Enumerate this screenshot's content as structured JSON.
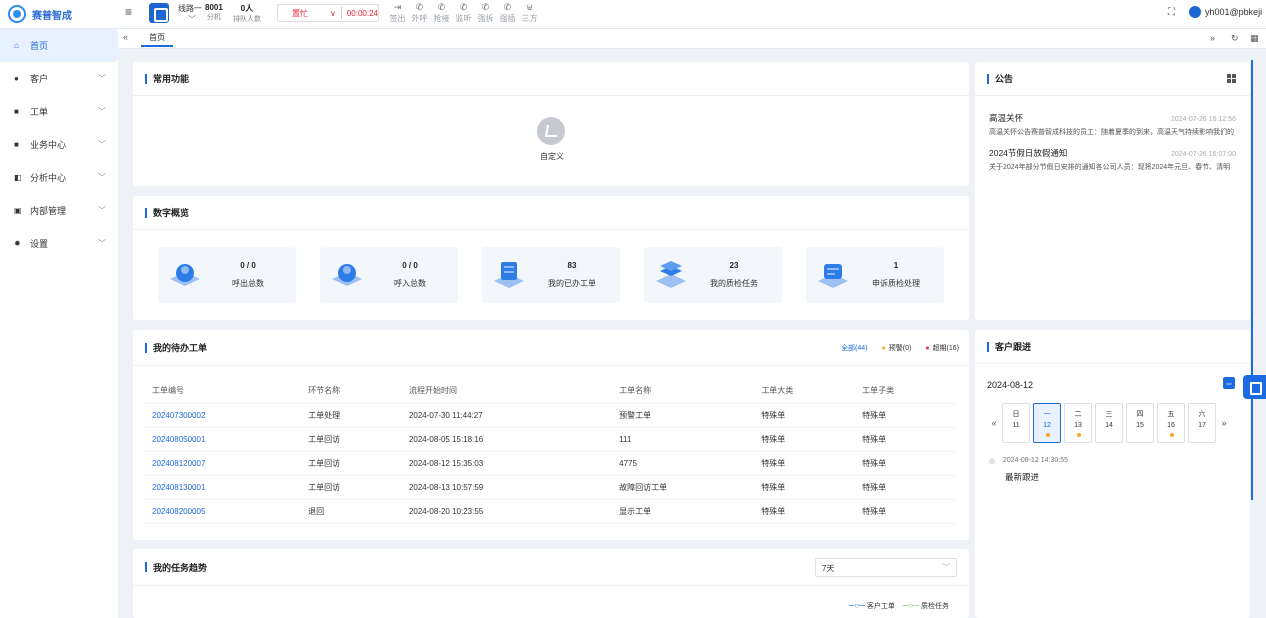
{
  "app": {
    "name": "赛普智成"
  },
  "topbar": {
    "line_label": "线路一",
    "extension": {
      "value": "8001",
      "label": "分机"
    },
    "queue": {
      "value": "0人",
      "label": "排队人数"
    },
    "agent_status": "置忙",
    "call_timer": "00:00:24",
    "tools": [
      "签出",
      "外呼",
      "抢接",
      "监听",
      "强拆",
      "强插",
      "三方"
    ],
    "username": "yh001@pbkeji"
  },
  "sidebar": {
    "items": [
      {
        "label": "首页",
        "icon": "home-icon",
        "active": true
      },
      {
        "label": "客户",
        "icon": "customer-icon"
      },
      {
        "label": "工单",
        "icon": "ticket-icon"
      },
      {
        "label": "业务中心",
        "icon": "business-icon"
      },
      {
        "label": "分析中心",
        "icon": "analytics-icon"
      },
      {
        "label": "内部管理",
        "icon": "internal-icon"
      },
      {
        "label": "设置",
        "icon": "settings-icon"
      }
    ]
  },
  "tabs": {
    "active": "首页"
  },
  "common_functions": {
    "title": "常用功能",
    "custom_label": "自定义"
  },
  "overview": {
    "title": "数字概览",
    "stats": [
      {
        "value": "0 / 0",
        "label": "呼出总数"
      },
      {
        "value": "0 / 0",
        "label": "呼入总数"
      },
      {
        "value": "83",
        "label": "我的已办工单"
      },
      {
        "value": "23",
        "label": "我的质检任务"
      },
      {
        "value": "1",
        "label": "申诉质检处理"
      }
    ]
  },
  "pending_orders": {
    "title": "我的待办工单",
    "filters": {
      "all": "全部(44)",
      "warning": "预警(0)",
      "overdue": "超期(16)"
    },
    "columns": [
      "工单编号",
      "环节名称",
      "流程开始时间",
      "工单名称",
      "工单大类",
      "工单子类"
    ],
    "rows": [
      [
        "202407300002",
        "工单处理",
        "2024-07-30 11:44:27",
        "预警工单",
        "特殊单",
        "特殊单"
      ],
      [
        "202408050001",
        "工单回访",
        "2024-08-05 15:18:16",
        "111",
        "特殊单",
        "特殊单"
      ],
      [
        "202408120007",
        "工单回访",
        "2024-08-12 15:35:03",
        "4775",
        "特殊单",
        "特殊单"
      ],
      [
        "202408130001",
        "工单回访",
        "2024-08-13 10:57:59",
        "故障回访工单",
        "特殊单",
        "特殊单"
      ],
      [
        "202408200005",
        "退回",
        "2024-08-20 10:23:55",
        "显示工单",
        "特殊单",
        "特殊单"
      ]
    ]
  },
  "task_trend": {
    "title": "我的任务趋势",
    "range": "7天",
    "legend": [
      "客户工单",
      "质检任务"
    ]
  },
  "announcements": {
    "title": "公告",
    "items": [
      {
        "title": "高温关怀",
        "date": "2024-07-26 16:12:56",
        "body": "高温关怀公告赛普智成科技的员工：随着夏季的到来，高温天气持续影响我们的"
      },
      {
        "title": "2024节假日放假通知",
        "date": "2024-07-26 16:07:00",
        "body": "关于2024年部分节假日安排的通知各公司人员：现将2024年元旦、春节、清明"
      }
    ]
  },
  "customer_followup": {
    "title": "客户跟进",
    "date": "2024-08-12",
    "week": [
      {
        "dow": "日",
        "day": "11",
        "dot": false,
        "selected": false
      },
      {
        "dow": "一",
        "day": "12",
        "dot": true,
        "selected": true
      },
      {
        "dow": "二",
        "day": "13",
        "dot": true,
        "selected": false
      },
      {
        "dow": "三",
        "day": "14",
        "dot": false,
        "selected": false
      },
      {
        "dow": "四",
        "day": "15",
        "dot": false,
        "selected": false
      },
      {
        "dow": "五",
        "day": "16",
        "dot": true,
        "selected": false
      },
      {
        "dow": "六",
        "day": "17",
        "dot": false,
        "selected": false
      }
    ],
    "entry_time": "2024-08-12 14:30:55",
    "entry_text": "最新跟进"
  }
}
